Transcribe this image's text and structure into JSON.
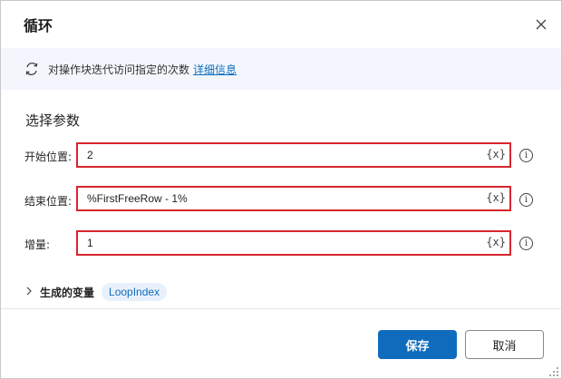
{
  "dialog": {
    "title": "循环",
    "close_icon": "close-icon"
  },
  "banner": {
    "icon": "loop-icon",
    "text": "对操作块迭代访问指定的次数",
    "link": "详细信息"
  },
  "section": {
    "title": "选择参数"
  },
  "params": [
    {
      "label": "开始位置:",
      "value": "2",
      "var_button": "{x}"
    },
    {
      "label": "结束位置:",
      "value": "%FirstFreeRow - 1%",
      "var_button": "{x}"
    },
    {
      "label": "增量:",
      "value": "1",
      "var_button": "{x}"
    }
  ],
  "generated": {
    "label": "生成的变量",
    "variable": "LoopIndex"
  },
  "footer": {
    "save": "保存",
    "cancel": "取消"
  },
  "colors": {
    "accent": "#0f6cbd",
    "highlight_border": "#d7262e",
    "banner_bg": "#f3f7fd"
  }
}
